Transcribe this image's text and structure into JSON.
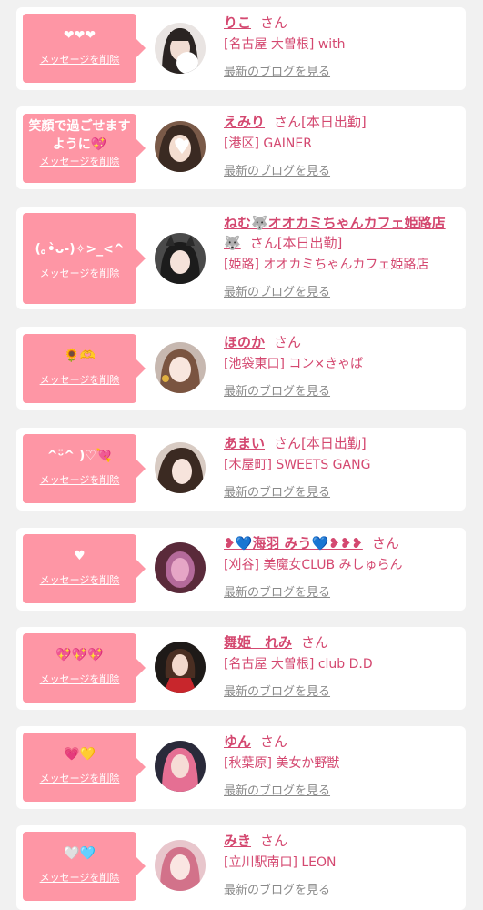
{
  "delete_label": "メッセージを削除",
  "san_label": "さん",
  "blog_label": "最新のブログを見る",
  "items": [
    {
      "message": "❤❤❤",
      "name": "りこ",
      "status": "",
      "shop": "[名古屋 大曽根] with"
    },
    {
      "message": "笑顔で過ごせますように💖",
      "name": "えみり",
      "status": "[本日出勤]",
      "shop": "[港区] GAINER"
    },
    {
      "message": "(｡•̀ᴗ-)✧>_<^",
      "name": "ねむ🐺オオカミちゃんカフェ姫路店🐺",
      "status": "[本日出勤]",
      "shop": "[姫路] オオカミちゃんカフェ姫路店"
    },
    {
      "message": "🌻🫶",
      "name": "ほのか",
      "status": "",
      "shop": "[池袋東口] コン×きゃば"
    },
    {
      "message": "^ᵕ̈^ )♡💘",
      "name": "あまい",
      "status": "[本日出勤]",
      "shop": "[木屋町] SWEETS GANG"
    },
    {
      "message": "♥",
      "name": "❥💙海羽 みう💙❥❥❥",
      "status": "",
      "shop": "[刈谷] 美魔女CLUB みしゅらん"
    },
    {
      "message": "💖💖💖",
      "name": "舞姫　れみ",
      "status": "",
      "shop": "[名古屋 大曽根] club D.D"
    },
    {
      "message": "💗💛",
      "name": "ゆん",
      "status": "",
      "shop": "[秋葉原] 美女か野獣"
    },
    {
      "message": "🤍🩵",
      "name": "みき",
      "status": "",
      "shop": "[立川駅南口] LEON"
    }
  ]
}
